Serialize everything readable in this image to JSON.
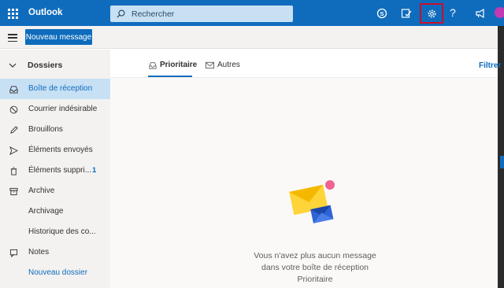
{
  "app": {
    "brand": "Outlook"
  },
  "search": {
    "placeholder": "Rechercher"
  },
  "header": {
    "icons": [
      "waffle-icon",
      "skype-icon",
      "todo-icon",
      "settings-icon",
      "help-icon",
      "megaphone-icon",
      "avatar"
    ],
    "help_label": "?"
  },
  "toolbar": {
    "new_message_label": "Nouveau message"
  },
  "sidebar": {
    "section_label": "Dossiers",
    "items": [
      {
        "label": "Boîte de réception",
        "icon": "inbox-icon",
        "selected": true
      },
      {
        "label": "Courrier indésirable",
        "icon": "junk-icon"
      },
      {
        "label": "Brouillons",
        "icon": "pencil-icon"
      },
      {
        "label": "Éléments envoyés",
        "icon": "send-icon"
      },
      {
        "label": "Éléments suppri...",
        "icon": "trash-icon",
        "count": "1"
      },
      {
        "label": "Archive",
        "icon": "archive-icon"
      },
      {
        "label": "Archivage",
        "icon": ""
      },
      {
        "label": "Historique des co...",
        "icon": ""
      },
      {
        "label": "Notes",
        "icon": "note-icon"
      },
      {
        "label": "Nouveau dossier",
        "icon": "",
        "link": true
      }
    ]
  },
  "main": {
    "tabs": [
      {
        "label": "Prioritaire",
        "active": true
      },
      {
        "label": "Autres",
        "active": false
      }
    ],
    "filter_label": "Filtrer",
    "empty_message": "Vous n'avez plus aucun message dans votre boîte de réception Prioritaire"
  },
  "colors": {
    "accent": "#0f6cbd",
    "selected_bg": "#c7e0f4",
    "highlight_border": "#c8102e"
  }
}
